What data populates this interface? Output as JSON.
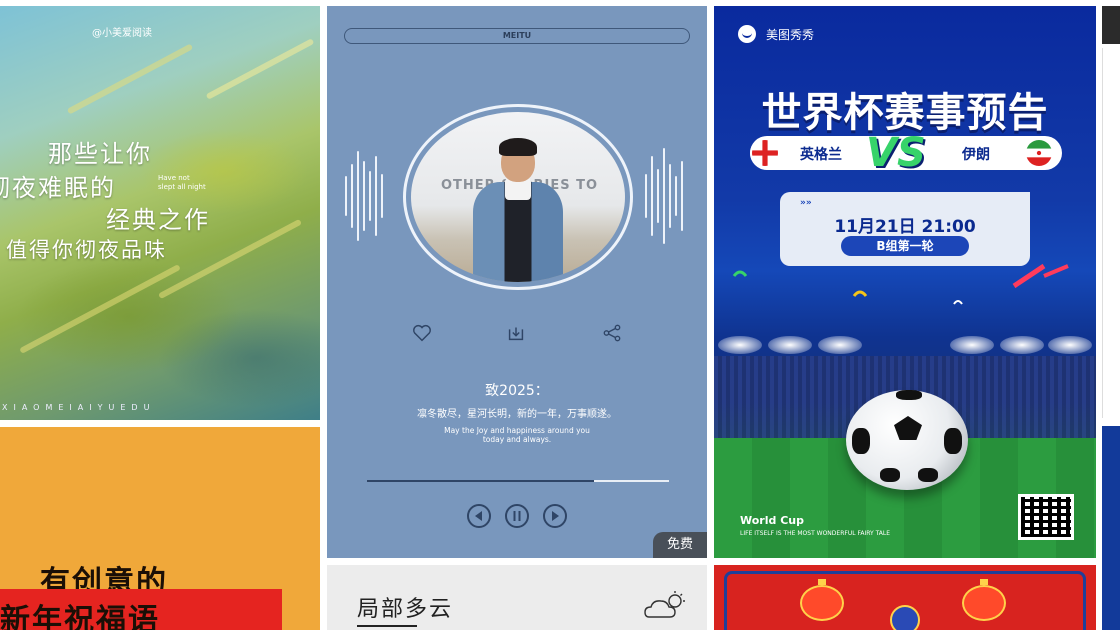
{
  "cards": {
    "reeds": {
      "handle": "@小美爱阅读",
      "lines": [
        "那些让你",
        "彻夜难眠的",
        "经典之作",
        "值得你彻夜品味"
      ],
      "english": [
        "Have not",
        "slept all night"
      ],
      "footer": "XIAOMEIAIYUEDU"
    },
    "music": {
      "brand": "MEITU",
      "photo_text": "OTHER STORIES TO",
      "title": "致2025：",
      "wish": "凛冬散尽，星河长明，新的一年，万事顺遂。",
      "english_1": "May the Joy and happiness around you",
      "english_2": "today and always.",
      "progress": 0.75,
      "badge": "免费",
      "icons": [
        "heart-icon",
        "download-icon",
        "share-icon",
        "previous-icon",
        "pause-icon",
        "next-icon"
      ]
    },
    "worldcup": {
      "brand": "美图秀秀",
      "headline": "世界杯赛事预告",
      "team_left": "英格兰",
      "vs": "VS",
      "team_right": "伊朗",
      "arrows": "»»",
      "datetime": "11月21日 21:00",
      "group": "B组第一轮",
      "footer_title": "World Cup",
      "footer_tagline": "LIFE ITSELF IS THE MOST WONDERFUL FAIRY TALE"
    },
    "newyear": {
      "line1": "有创意的",
      "line2": "新年祝福语"
    },
    "weather": {
      "title": "局部多云",
      "icon": "cloud-sun-icon"
    }
  },
  "colors": {
    "music_bg": "#7997bd",
    "worldcup_bg": "#0a2a9e",
    "newyear_bg": "#f0a83a",
    "lantern_bg": "#d8231f"
  }
}
